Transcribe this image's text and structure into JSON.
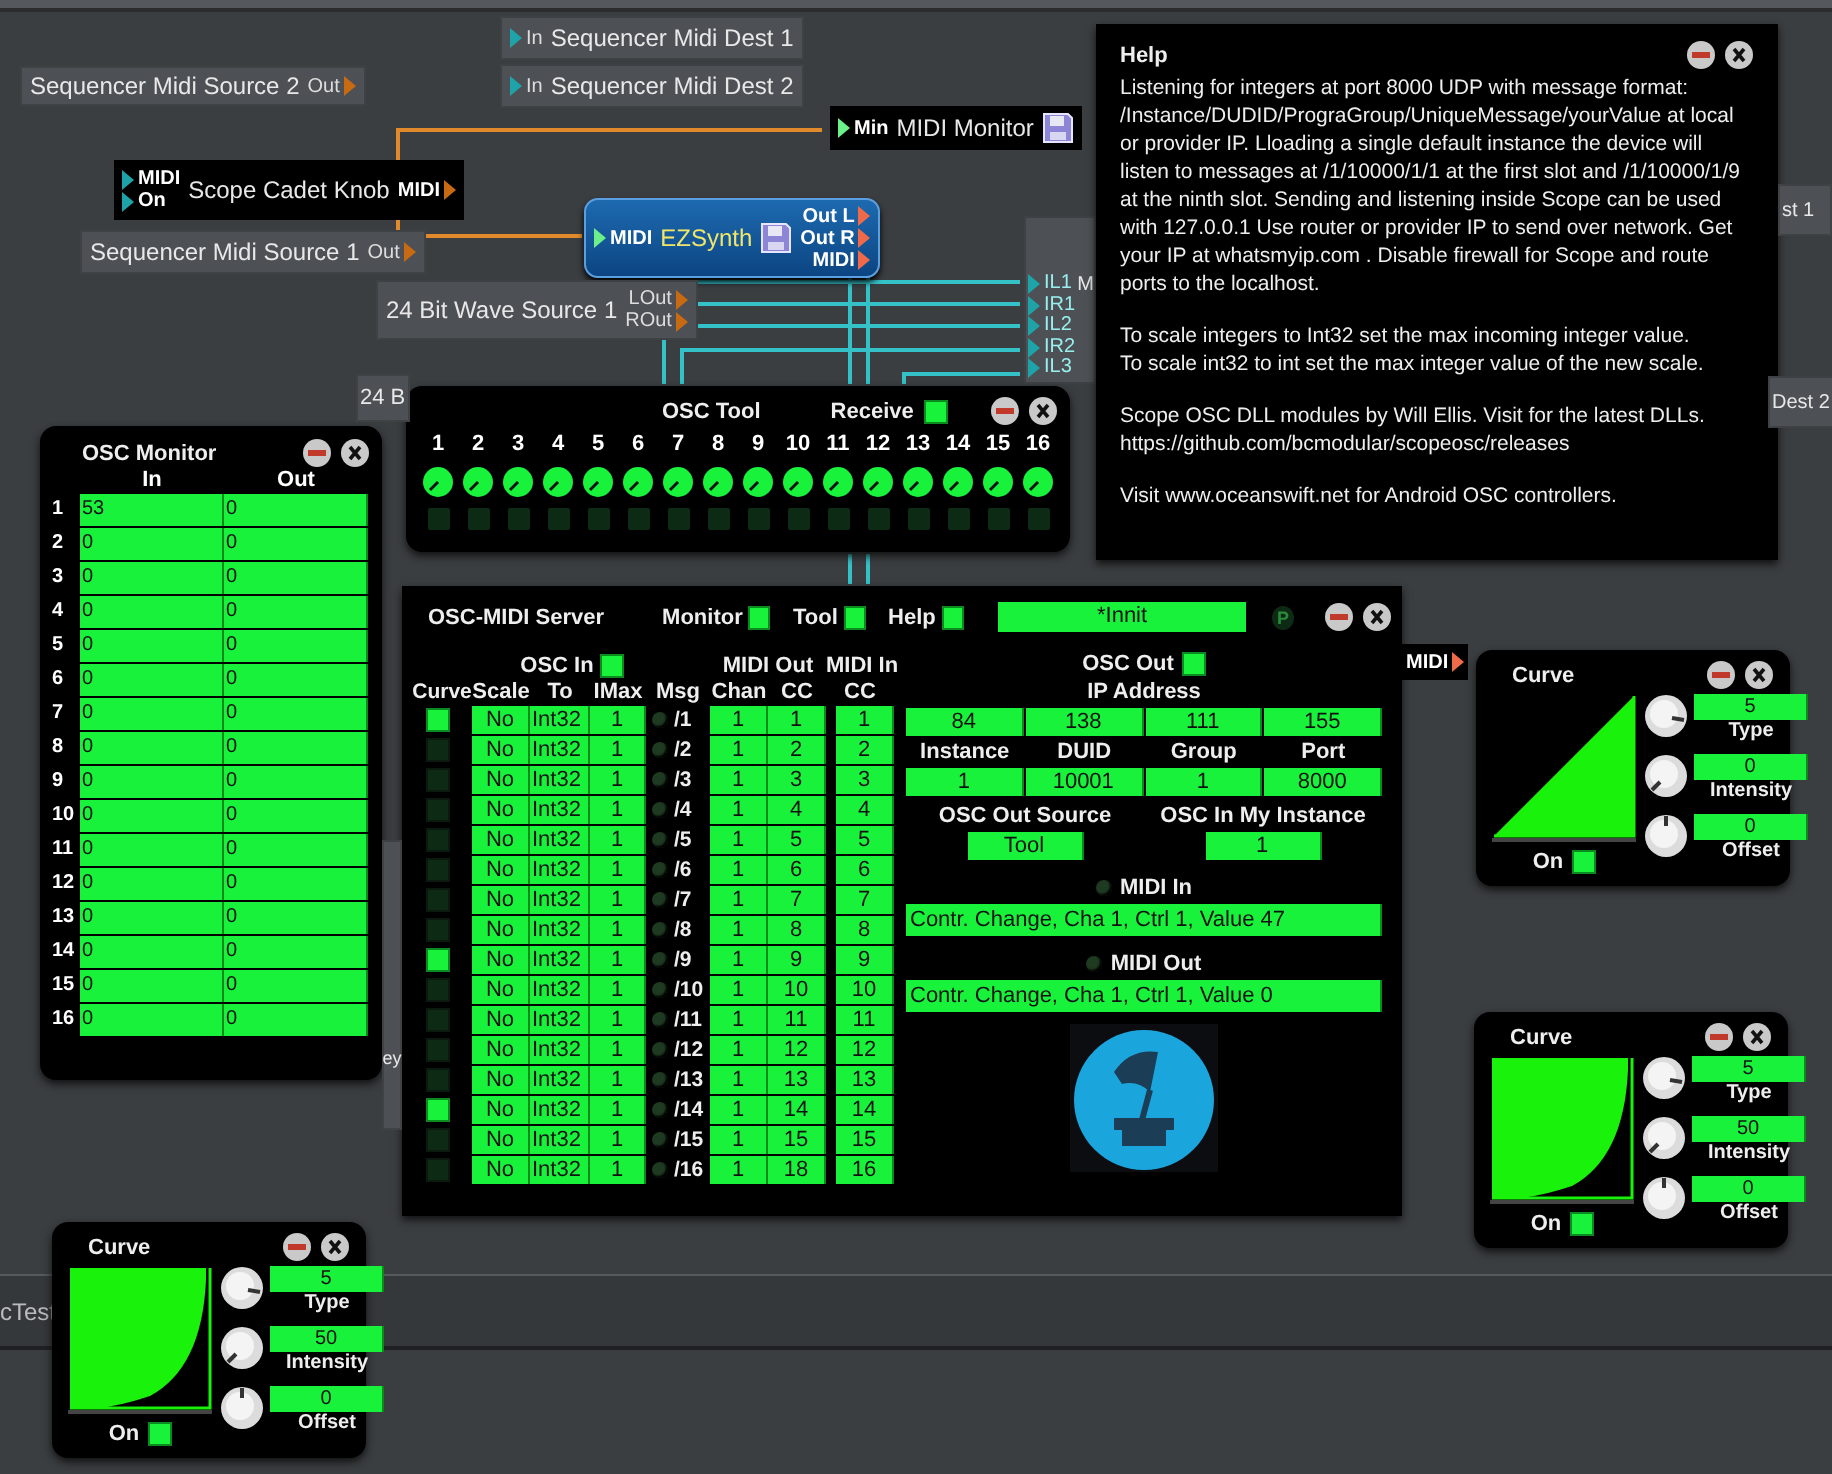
{
  "modules": [
    {
      "kind": "plain",
      "label": "Sequencer Midi Dest 1",
      "inputs": [
        "In"
      ]
    },
    {
      "kind": "plain",
      "label": "Sequencer Midi Source 2",
      "outputs": [
        "Out"
      ]
    },
    {
      "kind": "plain",
      "label": "Sequencer Midi Dest 2",
      "inputs": [
        "In"
      ]
    },
    {
      "kind": "monitor",
      "label": "MIDI Monitor",
      "inputs": [
        "Min"
      ]
    },
    {
      "kind": "dark",
      "label": "Scope Cadet Knob",
      "inputs": [
        "MIDI",
        "On"
      ],
      "outputs": [
        "MIDI"
      ]
    },
    {
      "kind": "synth",
      "label": "EZSynth",
      "inputs": [
        "MIDI"
      ],
      "outputs": [
        "Out L",
        "Out R",
        "MIDI"
      ]
    },
    {
      "kind": "plain",
      "label": "st 1"
    },
    {
      "kind": "plain",
      "label": "Sequencer Midi Source 1",
      "outputs": [
        "Out"
      ]
    },
    {
      "kind": "mixer",
      "label": "M",
      "inputs": [
        "IL1",
        "IR1",
        "IL2",
        "IR2",
        "IL3"
      ]
    },
    {
      "kind": "plain",
      "label": "24 Bit Wave Source 1",
      "outputs": [
        "LOut",
        "ROut"
      ]
    },
    {
      "kind": "plain",
      "label": "24 B"
    },
    {
      "kind": "plain",
      "label": "Dest 2"
    },
    {
      "kind": "dark",
      "outputs": [
        "MIDI"
      ]
    },
    {
      "kind": "plain",
      "label": "ey"
    }
  ],
  "dock": {
    "label": "cTest"
  },
  "help": {
    "title": "Help",
    "paragraphs": [
      "Listening for integers at port 8000 UDP with message format: /Instance/DUDID/PrograGroup/UniqueMessage/yourValue at local or provider IP. Lloading a single default instance the device will listen to messages at /1/10000/1/1 at the first slot and /1/10000/1/9 at the ninth slot. Sending and listening inside Scope can be used with 127.0.0.1 Use router or provider IP to send over network. Get your IP at whatsmyip.com . Disable firewall for Scope and route ports to the localhost.",
      "To scale integers to Int32 set the max incoming integer value.\nTo scale int32 to int set the max integer value of the new scale.",
      "Scope OSC DLL modules by Will Ellis. Visit for the latest DLLs.\nhttps://github.com/bcmodular/scopeosc/releases",
      "Visit www.oceanswift.net for Android OSC controllers."
    ]
  },
  "osc_monitor": {
    "title": "OSC Monitor",
    "columns": [
      "In",
      "Out"
    ],
    "rows": [
      {
        "n": "1",
        "in": "53",
        "out": "0"
      },
      {
        "n": "2",
        "in": "0",
        "out": "0"
      },
      {
        "n": "3",
        "in": "0",
        "out": "0"
      },
      {
        "n": "4",
        "in": "0",
        "out": "0"
      },
      {
        "n": "5",
        "in": "0",
        "out": "0"
      },
      {
        "n": "6",
        "in": "0",
        "out": "0"
      },
      {
        "n": "7",
        "in": "0",
        "out": "0"
      },
      {
        "n": "8",
        "in": "0",
        "out": "0"
      },
      {
        "n": "9",
        "in": "0",
        "out": "0"
      },
      {
        "n": "10",
        "in": "0",
        "out": "0"
      },
      {
        "n": "11",
        "in": "0",
        "out": "0"
      },
      {
        "n": "12",
        "in": "0",
        "out": "0"
      },
      {
        "n": "13",
        "in": "0",
        "out": "0"
      },
      {
        "n": "14",
        "in": "0",
        "out": "0"
      },
      {
        "n": "15",
        "in": "0",
        "out": "0"
      },
      {
        "n": "16",
        "in": "0",
        "out": "0"
      }
    ]
  },
  "osc_tool": {
    "title": "OSC Tool",
    "receive": {
      "label": "Receive",
      "on": true
    },
    "channels": [
      {
        "n": "1",
        "lit": false
      },
      {
        "n": "2",
        "lit": false
      },
      {
        "n": "3",
        "lit": false
      },
      {
        "n": "4",
        "lit": false
      },
      {
        "n": "5",
        "lit": false
      },
      {
        "n": "6",
        "lit": false
      },
      {
        "n": "7",
        "lit": false
      },
      {
        "n": "8",
        "lit": false
      },
      {
        "n": "9",
        "lit": false
      },
      {
        "n": "10",
        "lit": false
      },
      {
        "n": "11",
        "lit": false
      },
      {
        "n": "12",
        "lit": false
      },
      {
        "n": "13",
        "lit": false
      },
      {
        "n": "14",
        "lit": false
      },
      {
        "n": "15",
        "lit": false
      },
      {
        "n": "16",
        "lit": false
      }
    ]
  },
  "server": {
    "title": "OSC-MIDI Server",
    "toggles": [
      {
        "label": "Monitor",
        "on": true
      },
      {
        "label": "Tool",
        "on": true
      },
      {
        "label": "Help",
        "on": true
      }
    ],
    "preset": "*Innit",
    "p_label": "P",
    "osc_in": {
      "label": "OSC In",
      "on": true
    },
    "midi_out_label": "MIDI Out",
    "midi_in_label": "MIDI In",
    "headers": [
      "Curve",
      "Scale",
      "To",
      "IMax",
      "Msg",
      "Chan",
      "CC",
      "CC"
    ],
    "rows": [
      {
        "curve": true,
        "scale": "No",
        "to": "Int32",
        "imax": "1",
        "led": false,
        "msg": "/1",
        "chan": "1",
        "cc": "1",
        "in_cc": "1"
      },
      {
        "curve": false,
        "scale": "No",
        "to": "Int32",
        "imax": "1",
        "led": false,
        "msg": "/2",
        "chan": "1",
        "cc": "2",
        "in_cc": "2"
      },
      {
        "curve": false,
        "scale": "No",
        "to": "Int32",
        "imax": "1",
        "led": false,
        "msg": "/3",
        "chan": "1",
        "cc": "3",
        "in_cc": "3"
      },
      {
        "curve": false,
        "scale": "No",
        "to": "Int32",
        "imax": "1",
        "led": false,
        "msg": "/4",
        "chan": "1",
        "cc": "4",
        "in_cc": "4"
      },
      {
        "curve": false,
        "scale": "No",
        "to": "Int32",
        "imax": "1",
        "led": false,
        "msg": "/5",
        "chan": "1",
        "cc": "5",
        "in_cc": "5"
      },
      {
        "curve": false,
        "scale": "No",
        "to": "Int32",
        "imax": "1",
        "led": false,
        "msg": "/6",
        "chan": "1",
        "cc": "6",
        "in_cc": "6"
      },
      {
        "curve": false,
        "scale": "No",
        "to": "Int32",
        "imax": "1",
        "led": false,
        "msg": "/7",
        "chan": "1",
        "cc": "7",
        "in_cc": "7"
      },
      {
        "curve": false,
        "scale": "No",
        "to": "Int32",
        "imax": "1",
        "led": false,
        "msg": "/8",
        "chan": "1",
        "cc": "8",
        "in_cc": "8"
      },
      {
        "curve": true,
        "scale": "No",
        "to": "Int32",
        "imax": "1",
        "led": false,
        "msg": "/9",
        "chan": "1",
        "cc": "9",
        "in_cc": "9"
      },
      {
        "curve": false,
        "scale": "No",
        "to": "Int32",
        "imax": "1",
        "led": false,
        "msg": "/10",
        "chan": "1",
        "cc": "10",
        "in_cc": "10"
      },
      {
        "curve": false,
        "scale": "No",
        "to": "Int32",
        "imax": "1",
        "led": false,
        "msg": "/11",
        "chan": "1",
        "cc": "11",
        "in_cc": "11"
      },
      {
        "curve": false,
        "scale": "No",
        "to": "Int32",
        "imax": "1",
        "led": false,
        "msg": "/12",
        "chan": "1",
        "cc": "12",
        "in_cc": "12"
      },
      {
        "curve": false,
        "scale": "No",
        "to": "Int32",
        "imax": "1",
        "led": false,
        "msg": "/13",
        "chan": "1",
        "cc": "13",
        "in_cc": "13"
      },
      {
        "curve": true,
        "scale": "No",
        "to": "Int32",
        "imax": "1",
        "led": false,
        "msg": "/14",
        "chan": "1",
        "cc": "14",
        "in_cc": "14"
      },
      {
        "curve": false,
        "scale": "No",
        "to": "Int32",
        "imax": "1",
        "led": false,
        "msg": "/15",
        "chan": "1",
        "cc": "15",
        "in_cc": "15"
      },
      {
        "curve": false,
        "scale": "No",
        "to": "Int32",
        "imax": "1",
        "led": false,
        "msg": "/16",
        "chan": "1",
        "cc": "18",
        "in_cc": "16"
      }
    ],
    "osc_out": {
      "label": "OSC Out",
      "on": true
    },
    "ip_label": "IP Address",
    "ip": [
      "84",
      "138",
      "111",
      "155"
    ],
    "fields": [
      {
        "label": "Instance",
        "value": "1"
      },
      {
        "label": "DUID",
        "value": "10001"
      },
      {
        "label": "Group",
        "value": "1"
      },
      {
        "label": "Port",
        "value": "8000"
      }
    ],
    "sources": [
      {
        "label": "OSC Out Source",
        "value": "Tool"
      },
      {
        "label": "OSC In My Instance",
        "value": "1"
      }
    ],
    "midi_in": {
      "label": "MIDI In",
      "led": false,
      "message": "Contr. Change, Cha 1, Ctrl 1, Value 47"
    },
    "midi_out": {
      "label": "MIDI Out",
      "led": false,
      "message": "Contr. Change, Cha 1, Ctrl 1, Value 0"
    }
  },
  "curves": [
    {
      "title": "Curve",
      "kind": "linear",
      "on_label": "On",
      "on": true,
      "params": [
        {
          "label": "Type",
          "value": "5"
        },
        {
          "label": "Intensity",
          "value": "0"
        },
        {
          "label": "Offset",
          "value": "0"
        }
      ]
    },
    {
      "title": "Curve",
      "kind": "exponential",
      "on_label": "On",
      "on": true,
      "params": [
        {
          "label": "Type",
          "value": "5"
        },
        {
          "label": "Intensity",
          "value": "50"
        },
        {
          "label": "Offset",
          "value": "0"
        }
      ]
    },
    {
      "title": "Curve",
      "kind": "exponential",
      "on_label": "On",
      "on": true,
      "params": [
        {
          "label": "Type",
          "value": "5"
        },
        {
          "label": "Intensity",
          "value": "50"
        },
        {
          "label": "Offset",
          "value": "0"
        }
      ]
    }
  ]
}
